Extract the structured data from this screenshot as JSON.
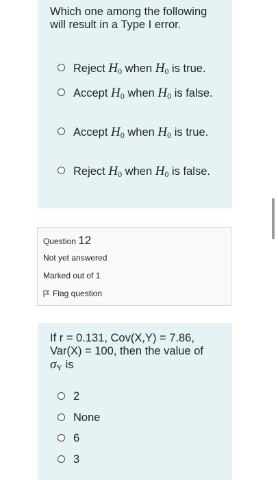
{
  "question11": {
    "text": "Which one among the following will result in a Type I error.",
    "options": [
      {
        "prefix": "Reject ",
        "mid": " when ",
        "suffix": " is true."
      },
      {
        "prefix": "Accept ",
        "mid": " when ",
        "suffix": " is false."
      },
      {
        "prefix": "Accept ",
        "mid": " when ",
        "suffix": " is true."
      },
      {
        "prefix": "Reject ",
        "mid": " when ",
        "suffix": " is false."
      }
    ],
    "math_symbol": "H",
    "math_sub": "0"
  },
  "info": {
    "question_label": "Question",
    "question_number": "12",
    "status": "Not yet answered",
    "marks": "Marked out of 1",
    "flag": "Flag question"
  },
  "question12": {
    "text_line1": "If r = 0.131, Cov(X,Y) = 7.86,",
    "text_line2": "Var(X) = 100, then the value of",
    "text_sigma": "σ",
    "text_sigma_sub": "Y",
    "text_line3_suffix": " is",
    "options": [
      "2",
      "None",
      "6",
      "3"
    ]
  }
}
